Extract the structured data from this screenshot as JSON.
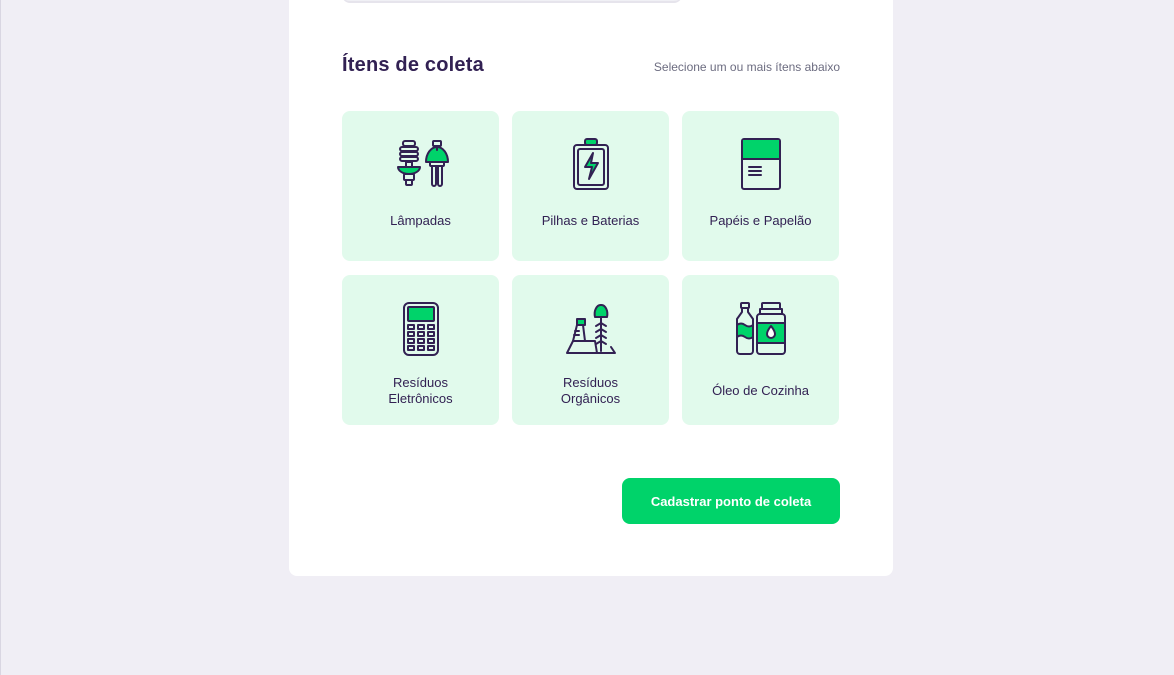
{
  "section": {
    "title": "Ítens de coleta",
    "hint": "Selecione um ou mais ítens abaixo"
  },
  "items": [
    {
      "label": "Lâmpadas",
      "icon": "lightbulbs-icon"
    },
    {
      "label": "Pilhas e Baterias",
      "icon": "battery-icon"
    },
    {
      "label": "Papéis e Papelão",
      "icon": "paper-icon"
    },
    {
      "label_line1": "Resíduos",
      "label_line2": "Eletrônicos",
      "icon": "electronic-device-icon"
    },
    {
      "label_line1": "Resíduos",
      "label_line2": "Orgânicos",
      "icon": "organic-waste-icon"
    },
    {
      "label": "Óleo de Cozinha",
      "icon": "cooking-oil-icon"
    }
  ],
  "submit": {
    "label": "Cadastrar ponto de coleta"
  },
  "colors": {
    "background": "#f0eef5",
    "card": "#ffffff",
    "item_background": "#e1faec",
    "title": "#322153",
    "text_muted": "#6c6c80",
    "accent_green": "#00d36a"
  }
}
